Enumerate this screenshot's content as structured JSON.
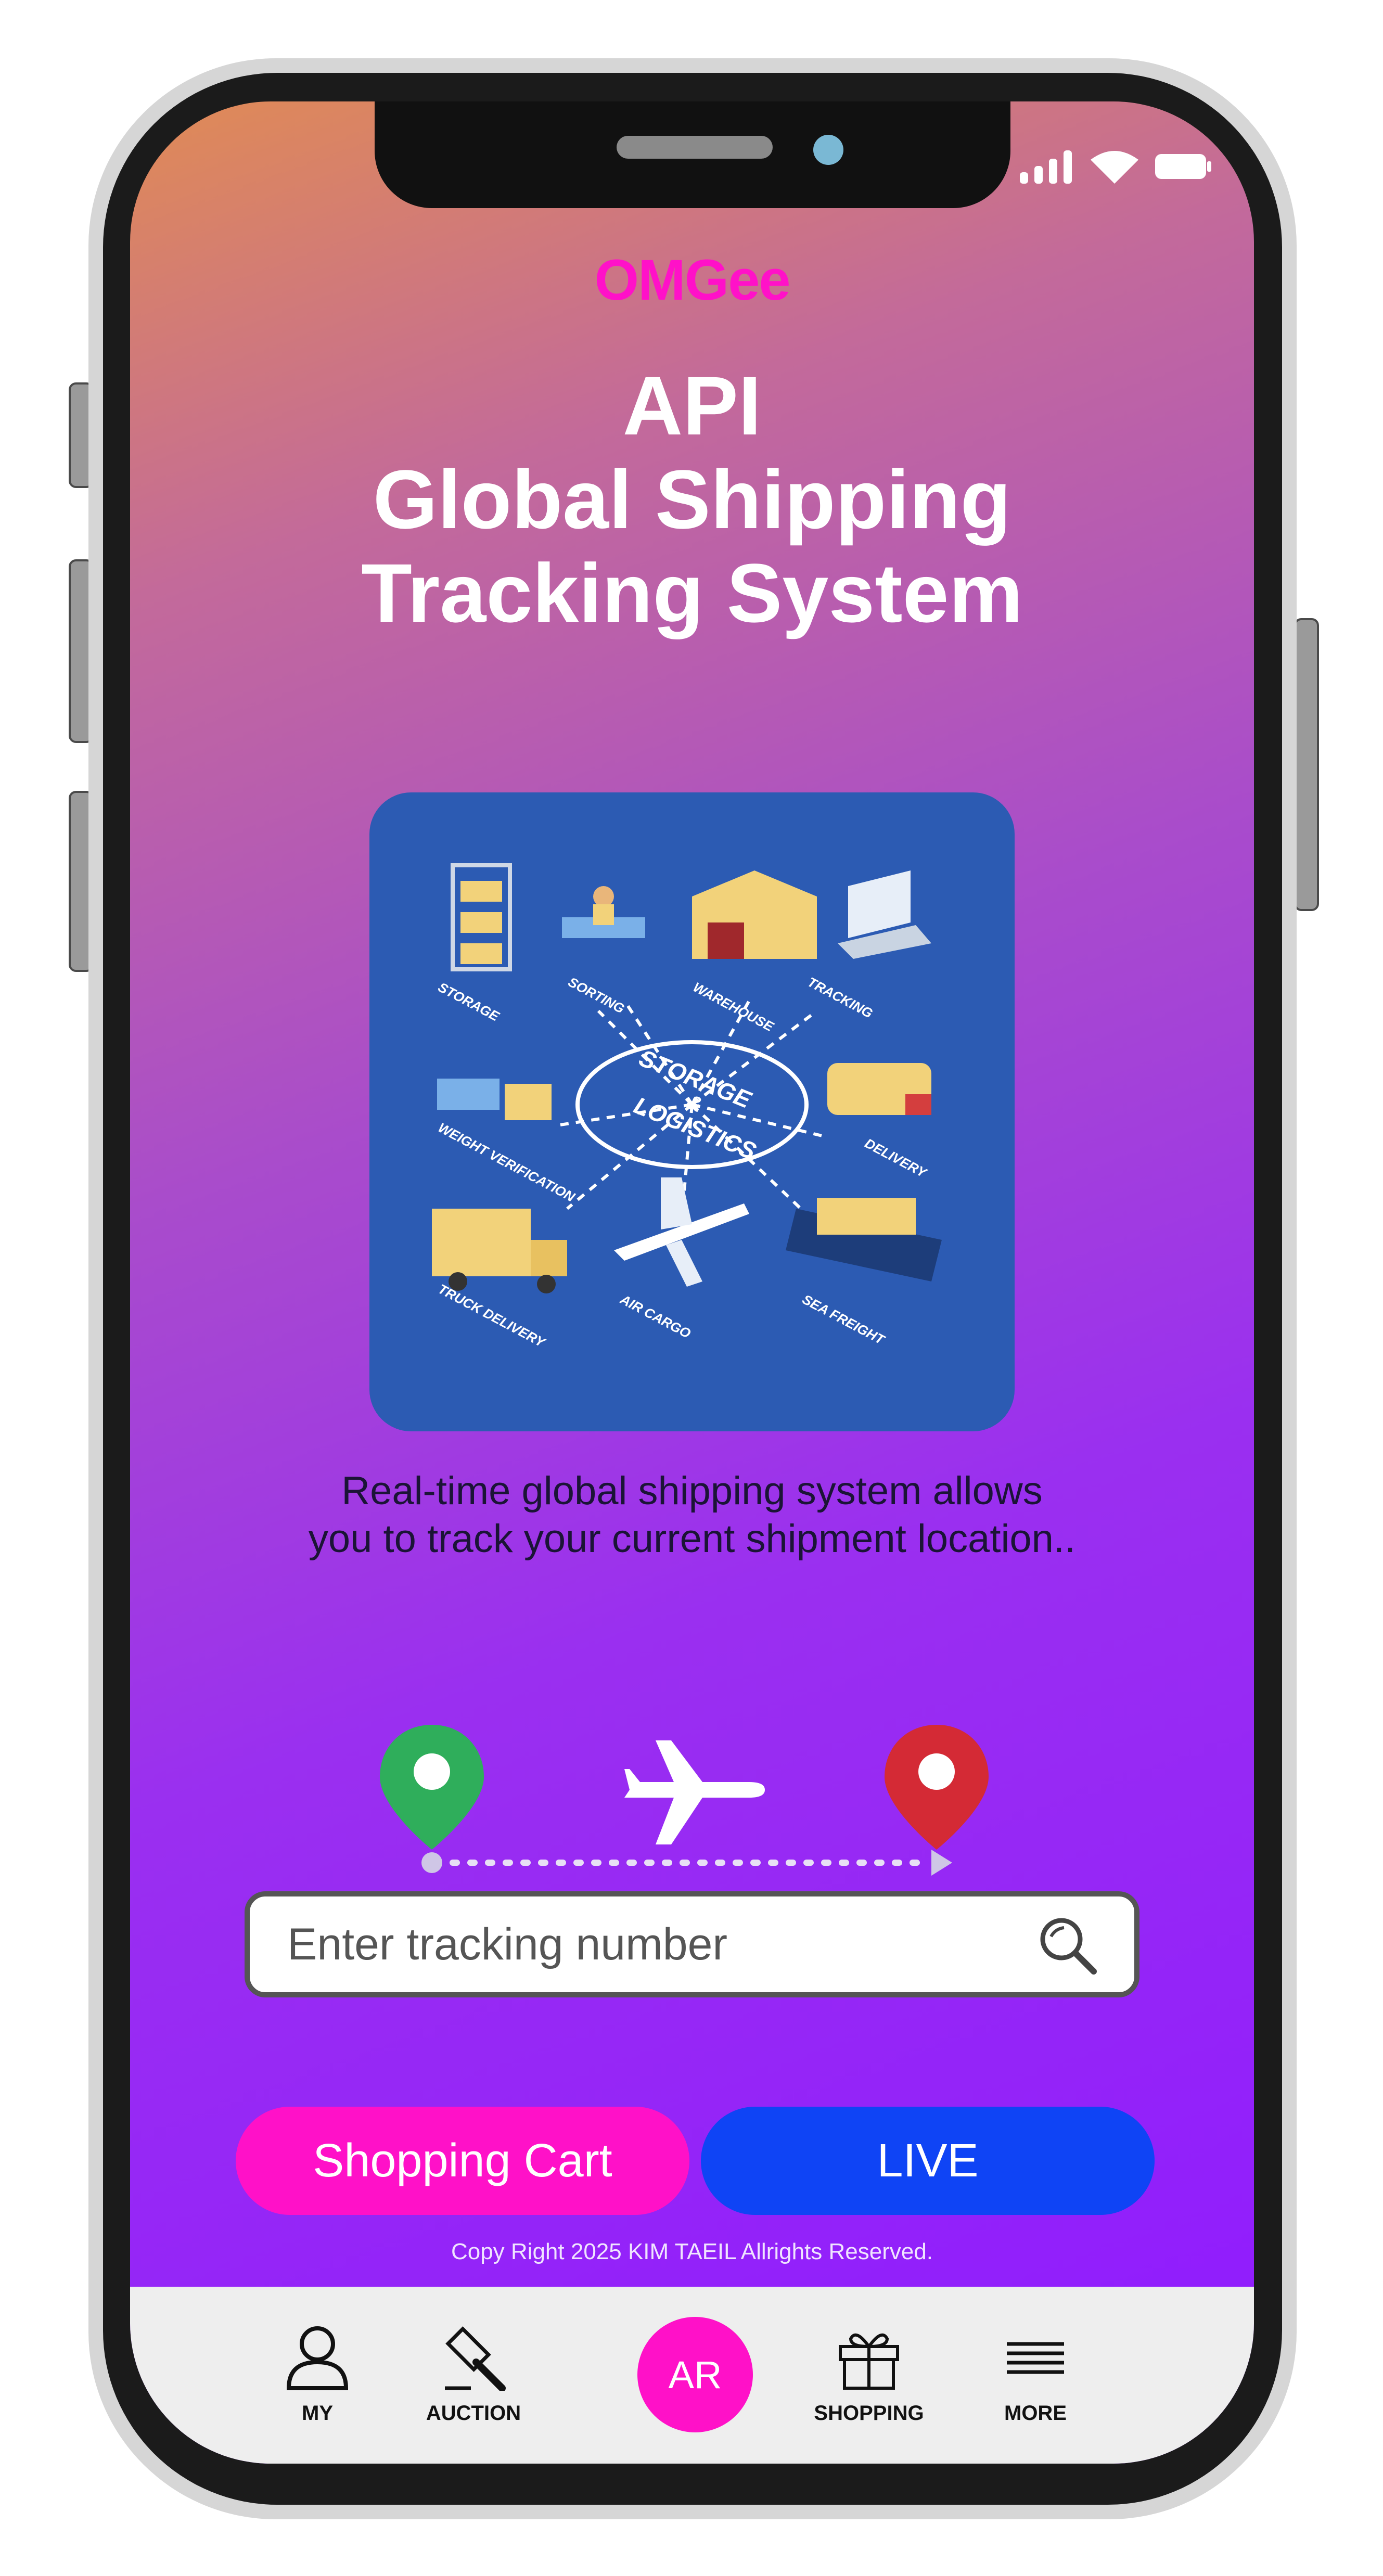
{
  "app": {
    "logo_text": "OMGee"
  },
  "hero": {
    "title_line1": "API",
    "title_line2": "Global Shipping",
    "title_line3": "Tracking System"
  },
  "illustration": {
    "center_label_1": "STORAGE",
    "center_label_2": "&",
    "center_label_3": "LOGISTICS",
    "items": [
      "STORAGE",
      "SORTING",
      "WAREHOUSE",
      "TRACKING",
      "WEIGHT VERIFICATION",
      "DELIVERY",
      "TRUCK DELIVERY",
      "AIR CARGO",
      "SEA FREIGHT"
    ]
  },
  "description": {
    "line1": "Real-time global shipping system allows",
    "line2": "you to track your current shipment location.."
  },
  "route": {
    "origin_color": "#2fae5b",
    "destination_color": "#d42a35"
  },
  "search": {
    "placeholder": "Enter tracking number"
  },
  "buttons": {
    "cart_label": "Shopping Cart",
    "live_label": "LIVE"
  },
  "footer": {
    "copyright": "Copy Right 2025 KIM TAEIL Allrights Reserved."
  },
  "nav": {
    "my": "MY",
    "auction": "AUCTION",
    "ar": "AR",
    "shopping": "SHOPPING",
    "more": "MORE"
  },
  "colors": {
    "accent_pink": "#ff11c8",
    "accent_blue": "#0f44f5"
  }
}
